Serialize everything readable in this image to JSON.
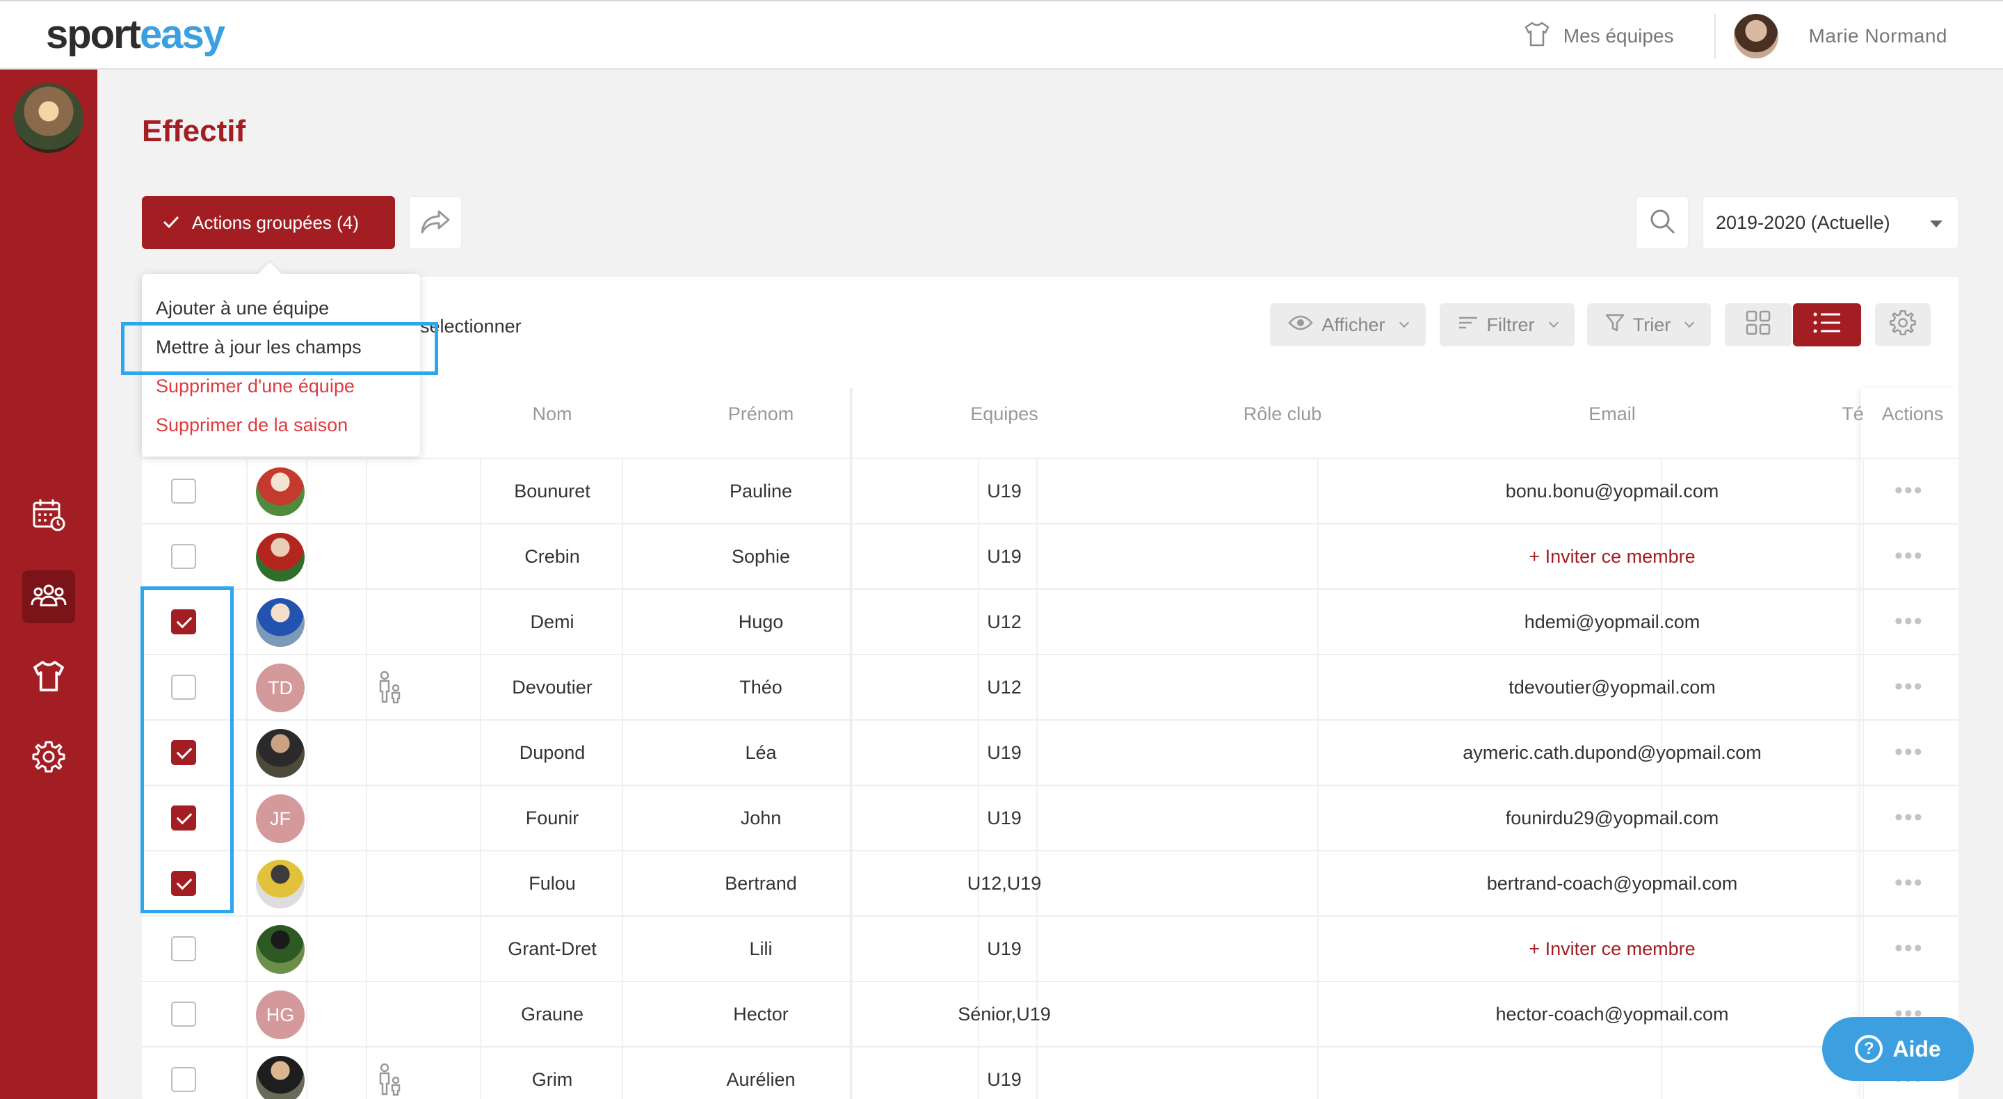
{
  "header": {
    "logo_part1": "sport",
    "logo_part2": "easy",
    "my_teams_label": "Mes équipes",
    "user_name": "Marie Normand"
  },
  "page": {
    "title": "Effectif"
  },
  "toolbar": {
    "group_actions_label": "Actions groupées (4)",
    "season_value": "2019-2020 (Actuelle)",
    "select_label": "selectionner",
    "display_label": "Afficher",
    "filter_label": "Filtrer",
    "sort_label": "Trier"
  },
  "dropdown": {
    "items": [
      "Ajouter à une équipe",
      "Mettre à jour les champs",
      "Supprimer d'une équipe",
      "Supprimer de la saison"
    ]
  },
  "table": {
    "headers": {
      "nom": "Nom",
      "prenom": "Prénom",
      "equipes": "Equipes",
      "role": "Rôle club",
      "email": "Email",
      "tel": "Té",
      "actions": "Actions"
    },
    "rows": [
      {
        "nom": "Bounuret",
        "prenom": "Pauline",
        "equipes": "U19",
        "email": "bonu.bonu@yopmail.com",
        "checked": false,
        "avatar": "photo",
        "invite": false,
        "guardian": false
      },
      {
        "nom": "Crebin",
        "prenom": "Sophie",
        "equipes": "U19",
        "email": "+ Inviter ce membre",
        "checked": false,
        "avatar": "photo",
        "invite": true,
        "guardian": false
      },
      {
        "nom": "Demi",
        "prenom": "Hugo",
        "equipes": "U12",
        "email": "hdemi@yopmail.com",
        "checked": true,
        "avatar": "photo",
        "invite": false,
        "guardian": false
      },
      {
        "nom": "Devoutier",
        "prenom": "Théo",
        "equipes": "U12",
        "email": "tdevoutier@yopmail.com",
        "checked": false,
        "avatar": "TD",
        "invite": false,
        "guardian": true
      },
      {
        "nom": "Dupond",
        "prenom": "Léa",
        "equipes": "U19",
        "email": "aymeric.cath.dupond@yopmail.com",
        "checked": true,
        "avatar": "photo",
        "invite": false,
        "guardian": false
      },
      {
        "nom": "Founir",
        "prenom": "John",
        "equipes": "U19",
        "email": "founirdu29@yopmail.com",
        "checked": true,
        "avatar": "JF",
        "invite": false,
        "guardian": false
      },
      {
        "nom": "Fulou",
        "prenom": "Bertrand",
        "equipes": "U12,U19",
        "email": "bertrand-coach@yopmail.com",
        "checked": true,
        "avatar": "photo",
        "invite": false,
        "guardian": false
      },
      {
        "nom": "Grant-Dret",
        "prenom": "Lili",
        "equipes": "U19",
        "email": "+ Inviter ce membre",
        "checked": false,
        "avatar": "photo",
        "invite": true,
        "guardian": false
      },
      {
        "nom": "Graune",
        "prenom": "Hector",
        "equipes": "Sénior,U19",
        "email": "hector-coach@yopmail.com",
        "checked": false,
        "avatar": "HG",
        "invite": false,
        "guardian": false
      },
      {
        "nom": "Grim",
        "prenom": "Aurélien",
        "equipes": "U19",
        "email": "",
        "checked": false,
        "avatar": "photo",
        "invite": false,
        "guardian": true
      }
    ]
  },
  "help": {
    "label": "Aide"
  },
  "colors": {
    "brand_red": "#a21e23",
    "brand_blue": "#3ca0e0",
    "highlight_blue": "#2ca7ee",
    "danger_text": "#e03a3e"
  }
}
